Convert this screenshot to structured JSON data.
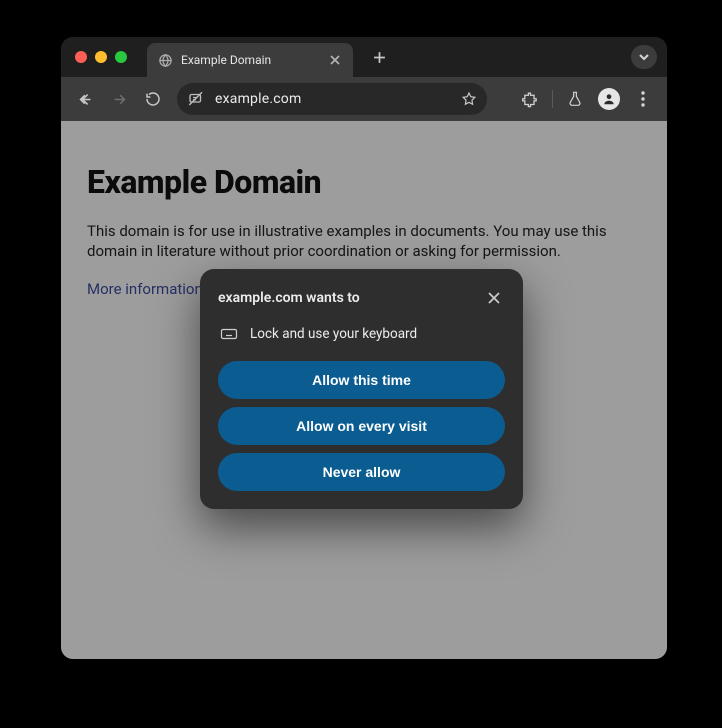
{
  "tab": {
    "title": "Example Domain"
  },
  "toolbar": {
    "url": "example.com"
  },
  "page": {
    "heading": "Example Domain",
    "paragraph": "This domain is for use in illustrative examples in documents. You may use this domain in literature without prior coordination or asking for permission.",
    "more_link": "More information..."
  },
  "dialog": {
    "title": "example.com wants to",
    "permission_label": "Lock and use your keyboard",
    "allow_once": "Allow this time",
    "allow_always": "Allow on every visit",
    "never": "Never allow"
  }
}
